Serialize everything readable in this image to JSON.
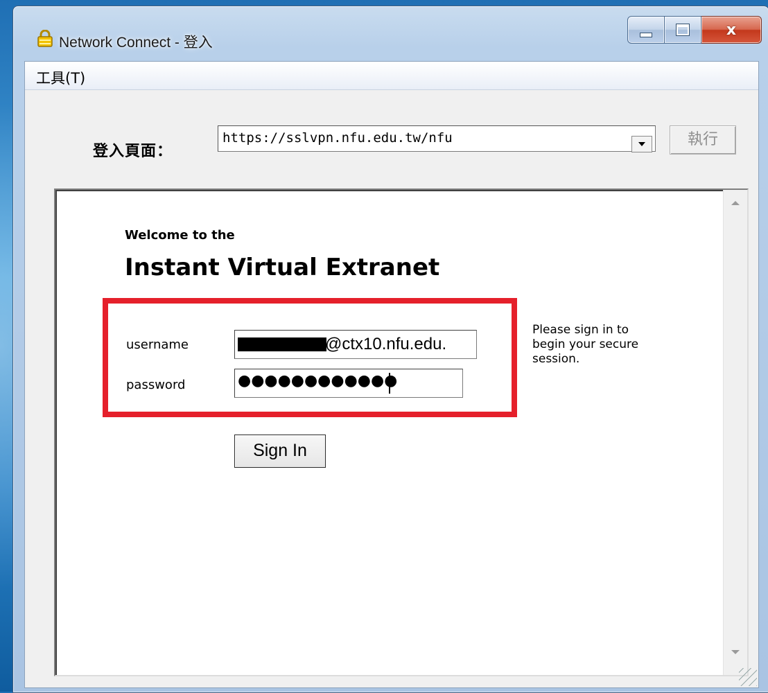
{
  "window": {
    "title": "Network Connect - 登入",
    "close_label": "x"
  },
  "menubar": {
    "items": [
      {
        "label": "工具(T)"
      }
    ]
  },
  "toolbar": {
    "url_label": "登入頁面：",
    "url_value": "https://sslvpn.nfu.edu.tw/nfu",
    "go_label": "執行"
  },
  "login": {
    "welcome": "Welcome to the",
    "product_name": "Instant Virtual Extranet",
    "username_label": "username",
    "username_value": "@ctx10.nfu.edu.",
    "password_label": "password",
    "password_value": "●●●●●●●●●●●●",
    "side_message": "Please sign in to begin your secure session.",
    "signin_label": "Sign In"
  },
  "colors": {
    "highlight": "#e5202b",
    "aero_frame": "#b8d0ea"
  }
}
